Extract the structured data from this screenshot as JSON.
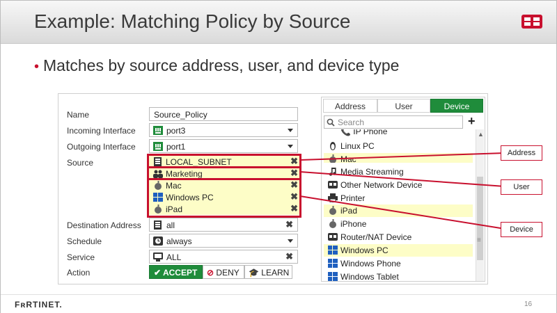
{
  "slide": {
    "title": "Example: Matching Policy by Source",
    "bullet": "Matches by source address, user, and device type",
    "page_number": "16",
    "brand": "FʀRTINET."
  },
  "form": {
    "labels": {
      "name": "Name",
      "incoming": "Incoming Interface",
      "outgoing": "Outgoing Interface",
      "source": "Source",
      "destination": "Destination Address",
      "schedule": "Schedule",
      "service": "Service",
      "action": "Action"
    },
    "name_value": "Source_Policy",
    "incoming_value": "port3",
    "outgoing_value": "port1",
    "source_items": [
      "LOCAL_SUBNET",
      "Marketing",
      "Mac",
      "Windows PC",
      "iPad"
    ],
    "destination_value": "all",
    "schedule_value": "always",
    "service_value": "ALL",
    "actions": [
      "ACCEPT",
      "DENY",
      "LEARN"
    ]
  },
  "panel": {
    "tabs": [
      "Address",
      "User",
      "Device"
    ],
    "active_tab": "Device",
    "search_placeholder": "Search",
    "items": [
      "IP Phone",
      "Linux PC",
      "Mac",
      "Media Streaming",
      "Other Network Device",
      "Printer",
      "iPad",
      "iPhone",
      "Router/NAT Device",
      "Windows PC",
      "Windows Phone",
      "Windows Tablet"
    ],
    "highlighted": [
      "Mac",
      "iPad",
      "Windows PC"
    ]
  },
  "callouts": {
    "address": "Address",
    "user": "User",
    "device": "Device"
  },
  "colors": {
    "accent_green": "#1f8c3b",
    "highlight_yellow": "#fdfdc7",
    "callout_red": "#c8102e"
  }
}
